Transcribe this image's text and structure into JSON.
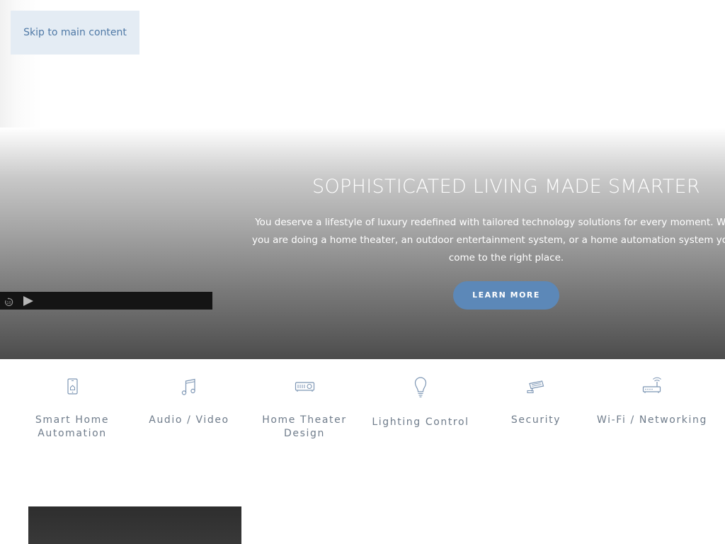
{
  "skip_link": {
    "label": "Skip to main content"
  },
  "hero": {
    "title": "SOPHISTICATED LIVING MADE SMARTER",
    "description": "You deserve a lifestyle of luxury redefined with tailored technology solutions for every moment. Whether you are doing a home theater, an outdoor entertainment system, or a home automation system you have come to the right place.",
    "cta_label": "LEARN MORE",
    "cta_color": "#5c88b8"
  },
  "video_player": {
    "replay_icon": "replay-10-icon",
    "replay_text": "10",
    "play_icon": "play-icon"
  },
  "services": [
    {
      "label": "Smart Home Automation",
      "icon": "smartphone-home-icon"
    },
    {
      "label": "Audio / Video",
      "icon": "music-note-icon"
    },
    {
      "label": "Home Theater Design",
      "icon": "projector-icon"
    },
    {
      "label": "Lighting Control",
      "icon": "lightbulb-icon"
    },
    {
      "label": "Security",
      "icon": "security-camera-icon"
    },
    {
      "label": "Wi-Fi / Networking",
      "icon": "router-icon"
    }
  ],
  "colors": {
    "service_text": "#6f7c8b",
    "icon_stroke": "#7d96b4",
    "link": "#4f79a6"
  }
}
